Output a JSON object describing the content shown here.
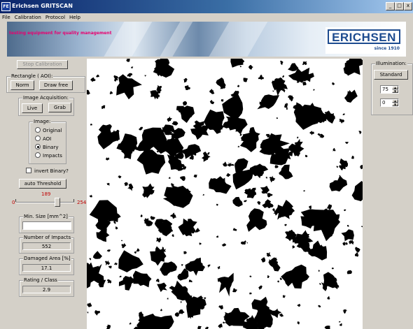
{
  "window": {
    "title": "Erichsen GRITSCAN",
    "app_icon": "FE",
    "min": "_",
    "max": "□",
    "close": "x"
  },
  "menu": [
    "File",
    "Calibration",
    "Protocol",
    "Help"
  ],
  "banner": {
    "tagline": "testing equipment for quality management",
    "logo": "ERICHSEN",
    "since": "since 1910"
  },
  "left": {
    "stop_calibration": "Stop Calibration",
    "rectangle_group": "Rectangle ( AOI):",
    "norm": "Norm",
    "draw_free": "Draw free",
    "acq_group": "Image Acquisition:",
    "live": "Live",
    "grab": "Grab",
    "image_group": "Image:",
    "image_options": [
      "Original",
      "AOI",
      "Binary",
      "Impacts"
    ],
    "image_selected": "Binary",
    "invert_binary": "invert Binary?",
    "auto_threshold": "auto Threshold",
    "threshold_value": "189",
    "threshold_min": "0",
    "threshold_max": "254",
    "min_size_label": "Min. Size [mm^2]",
    "min_size_value": "",
    "impacts_label": "Number of Impacts",
    "impacts_value": "552",
    "damaged_label": "Damaged Area [%]",
    "damaged_value": "17.1",
    "rating_label": "Rating / Class",
    "rating_value": "2.9"
  },
  "right": {
    "illumination_group": "Illumination:",
    "standard": "Standard",
    "spin1": "75",
    "spin2": "0"
  },
  "image": {
    "mode": "Binary",
    "foreground": "#000000",
    "background": "#ffffff"
  }
}
